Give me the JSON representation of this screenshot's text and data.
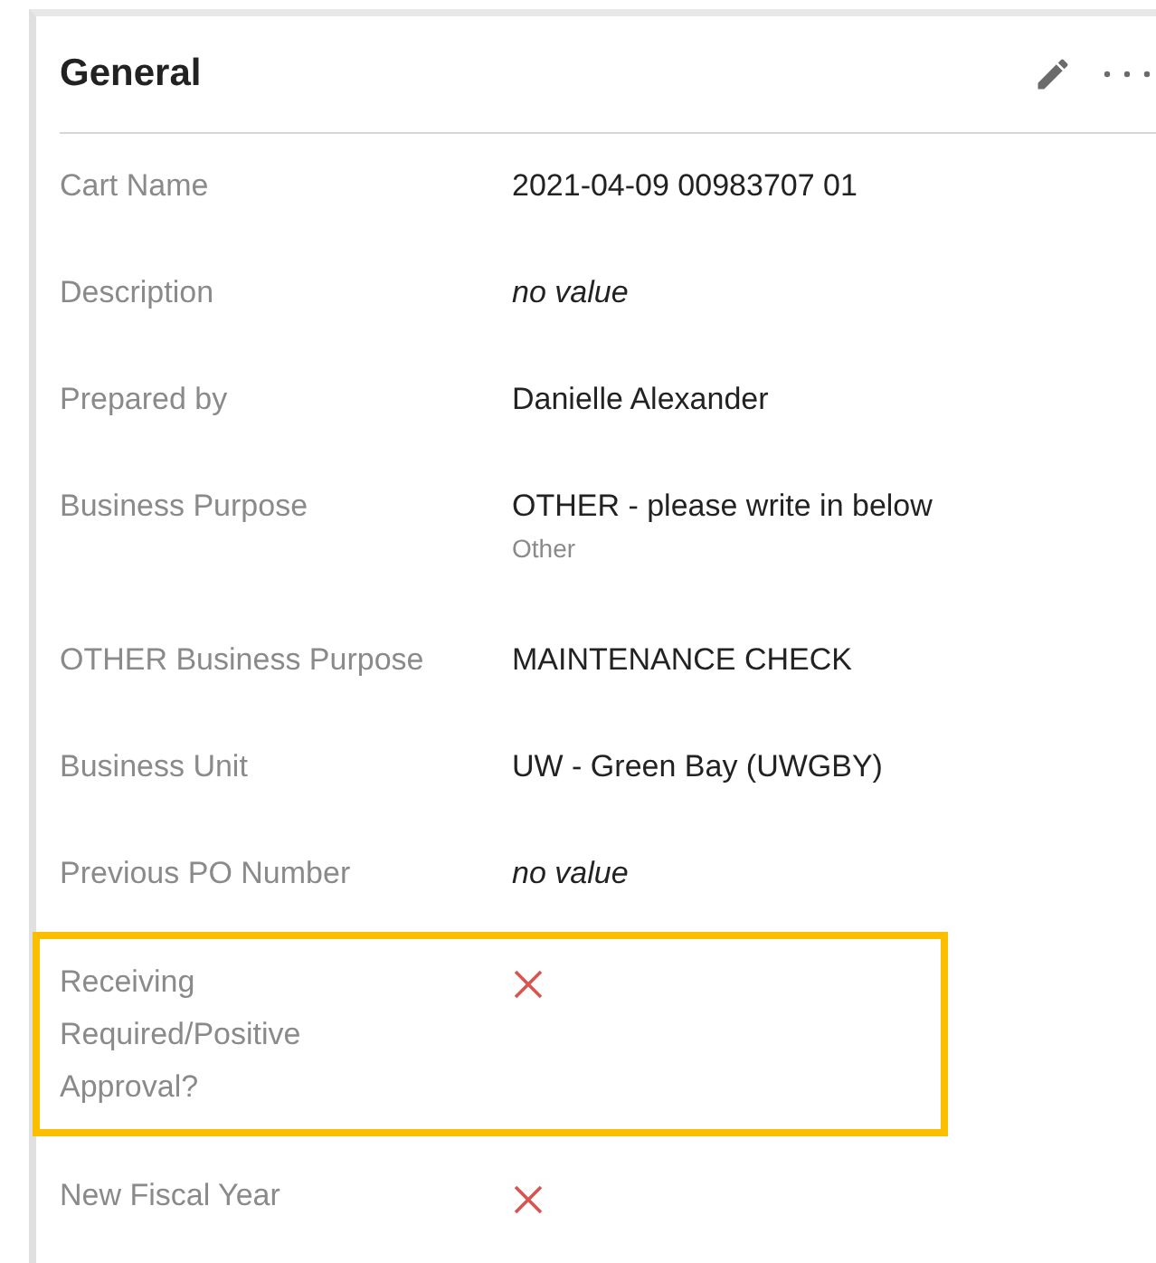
{
  "card": {
    "title": "General"
  },
  "fields": [
    {
      "label": "Cart Name",
      "kind": "text",
      "value": "2021-04-09 00983707 01",
      "highlighted": false
    },
    {
      "label": "Description",
      "kind": "empty",
      "value": "no value",
      "highlighted": false
    },
    {
      "label": "Prepared by",
      "kind": "text",
      "value": "Danielle Alexander",
      "highlighted": false
    },
    {
      "label": "Business Purpose",
      "kind": "text",
      "value": "OTHER - please write in below",
      "subtext": "Other",
      "highlighted": false
    },
    {
      "label": "OTHER Business Purpose",
      "kind": "text",
      "value": "MAINTENANCE CHECK",
      "highlighted": false
    },
    {
      "label": "Business Unit",
      "kind": "text",
      "value": "UW - Green Bay (UWGBY)",
      "highlighted": false
    },
    {
      "label": "Previous PO Number",
      "kind": "empty",
      "value": "no value",
      "highlighted": false
    },
    {
      "label": "Receiving Required/Positive Approval?",
      "kind": "bool",
      "checked": false,
      "highlighted": true
    },
    {
      "label": "New Fiscal Year",
      "kind": "bool",
      "checked": false,
      "highlighted": false
    }
  ]
}
